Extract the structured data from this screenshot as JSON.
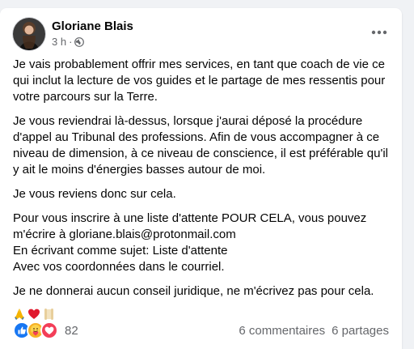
{
  "post": {
    "author": "Gloriane Blais",
    "time": "3 h",
    "separator": "·",
    "privacy_icon": "globe-icon",
    "paragraphs": [
      "Je vais probablement offrir mes services, en tant que coach de vie ce qui inclut la lecture de vos guides et le partage de mes ressentis pour votre parcours sur la Terre.",
      "Je vous reviendrai là-dessus, lorsque j'aurai déposé la procédure d'appel au Tribunal des professions. Afin de vous accompagner à ce niveau de dimension, à ce niveau de conscience, il est préférable qu'il y ait le moins d'énergies basses autour de moi.",
      "Je vous reviens donc sur cela.",
      "Pour vous inscrire à une liste d'attente POUR CELA, vous pouvez m'écrire à gloriane.blais@protonmail.com",
      "En écrivant comme sujet: Liste d'attente",
      "Avec vos coordonnées dans le courriel.",
      "Je ne donnerai aucun conseil juridique, ne m'écrivez pas pour cela."
    ],
    "emojis": [
      "🙏",
      "❤️",
      "📜"
    ]
  },
  "reactions": {
    "icons": [
      "like-reaction-icon",
      "care-reaction-icon",
      "love-reaction-icon"
    ],
    "count": "82",
    "comments": "6 commentaires",
    "shares": "6 partages"
  },
  "colors": {
    "like": "#1877f2",
    "love": "#f33e58",
    "care": "#f7b125",
    "secondary_text": "#65676b"
  }
}
